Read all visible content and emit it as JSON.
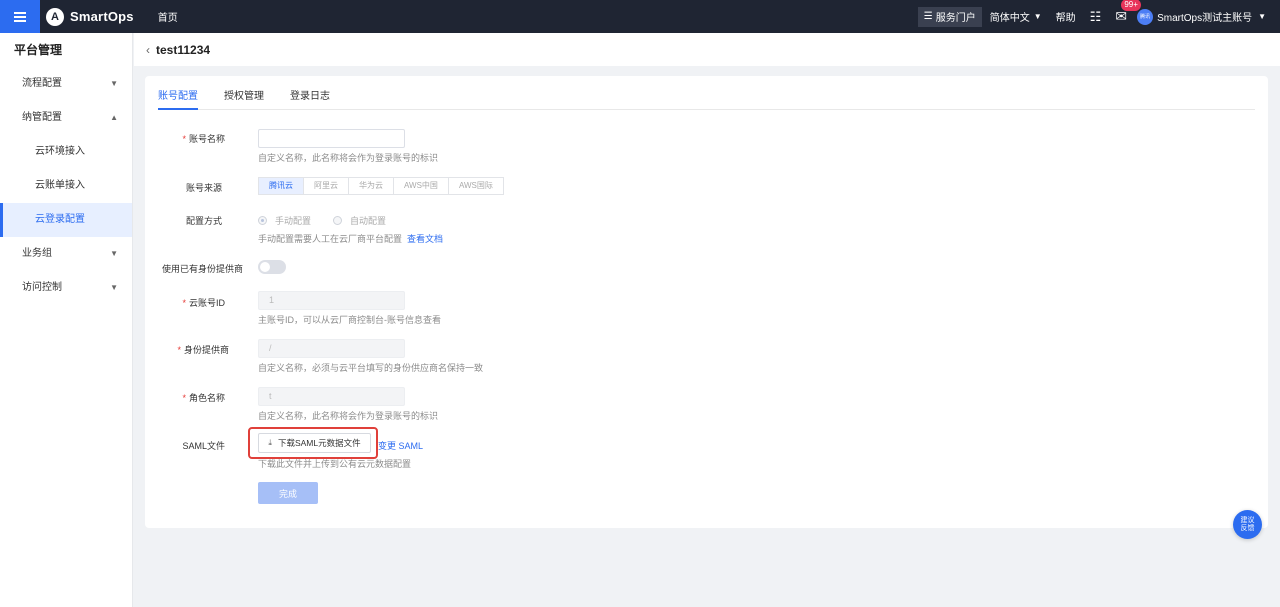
{
  "topbar": {
    "logo_mark": "A",
    "brand": "SmartOps",
    "home": "首页",
    "service_portal": "服务门户",
    "language": "简体中文",
    "help": "帮助",
    "mail_badge": "99+",
    "avatar_text": "腾讯",
    "account": "SmartOps测试主账号"
  },
  "sidebar": {
    "title": "平台管理",
    "items": [
      {
        "label": "流程配置"
      },
      {
        "label": "纳管配置"
      },
      {
        "label": "云环境接入"
      },
      {
        "label": "云账单接入"
      },
      {
        "label": "云登录配置"
      },
      {
        "label": "业务组"
      },
      {
        "label": "访问控制"
      }
    ]
  },
  "page": {
    "back": "‹",
    "title": "test11234"
  },
  "tabs": [
    "账号配置",
    "授权管理",
    "登录日志"
  ],
  "form": {
    "account_name": {
      "label": "账号名称",
      "hint": "自定义名称，此名称将会作为登录账号的标识"
    },
    "source": {
      "label": "账号来源",
      "options": [
        "腾讯云",
        "阿里云",
        "华为云",
        "AWS中国",
        "AWS国际"
      ]
    },
    "config_mode": {
      "label": "配置方式",
      "options": [
        "手动配置",
        "自动配置"
      ],
      "hint": "手动配置需要人工在云厂商平台配置",
      "hint_link": "查看文档"
    },
    "use_idp": {
      "label": "使用已有身份提供商"
    },
    "cloud_id": {
      "label": "云账号ID",
      "value": "1",
      "hint": "主账号ID，可以从云厂商控制台-账号信息查看"
    },
    "idp": {
      "label": "身份提供商",
      "value": "/",
      "hint": "自定义名称，必须与云平台填写的身份供应商名保持一致"
    },
    "role": {
      "label": "角色名称",
      "value": "t",
      "hint": "自定义名称，此名称将会作为登录账号的标识"
    },
    "saml": {
      "label": "SAML文件",
      "download": "下载SAML元数据文件",
      "link": "变更 SAML",
      "hint": "下载此文件并上传到公有云元数据配置"
    },
    "submit": "完成"
  },
  "feedback": {
    "line1": "建议",
    "line2": "反馈"
  }
}
